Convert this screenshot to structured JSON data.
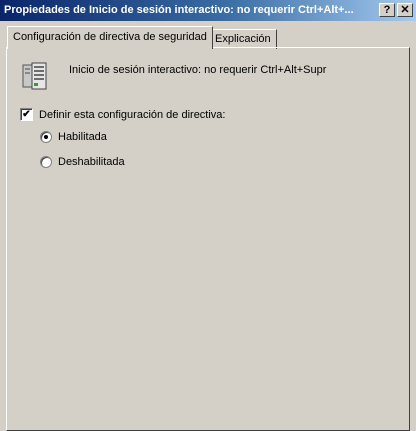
{
  "window": {
    "title": "Propiedades de Inicio de sesión interactivo: no requerir Ctrl+Alt+...",
    "help_button": "?",
    "close_button": "✕"
  },
  "tabs": [
    {
      "label": "Configuración de directiva de seguridad",
      "active": true
    },
    {
      "label": "Explicación",
      "active": false
    }
  ],
  "policy": {
    "icon": "server-policy-icon",
    "name": "Inicio de sesión interactivo: no requerir Ctrl+Alt+Supr"
  },
  "define_setting": {
    "label": "Definir esta configuración de directiva:",
    "checked": true,
    "check_glyph": "✔"
  },
  "options": [
    {
      "label": "Habilitada",
      "selected": true
    },
    {
      "label": "Deshabilitada",
      "selected": false
    }
  ]
}
